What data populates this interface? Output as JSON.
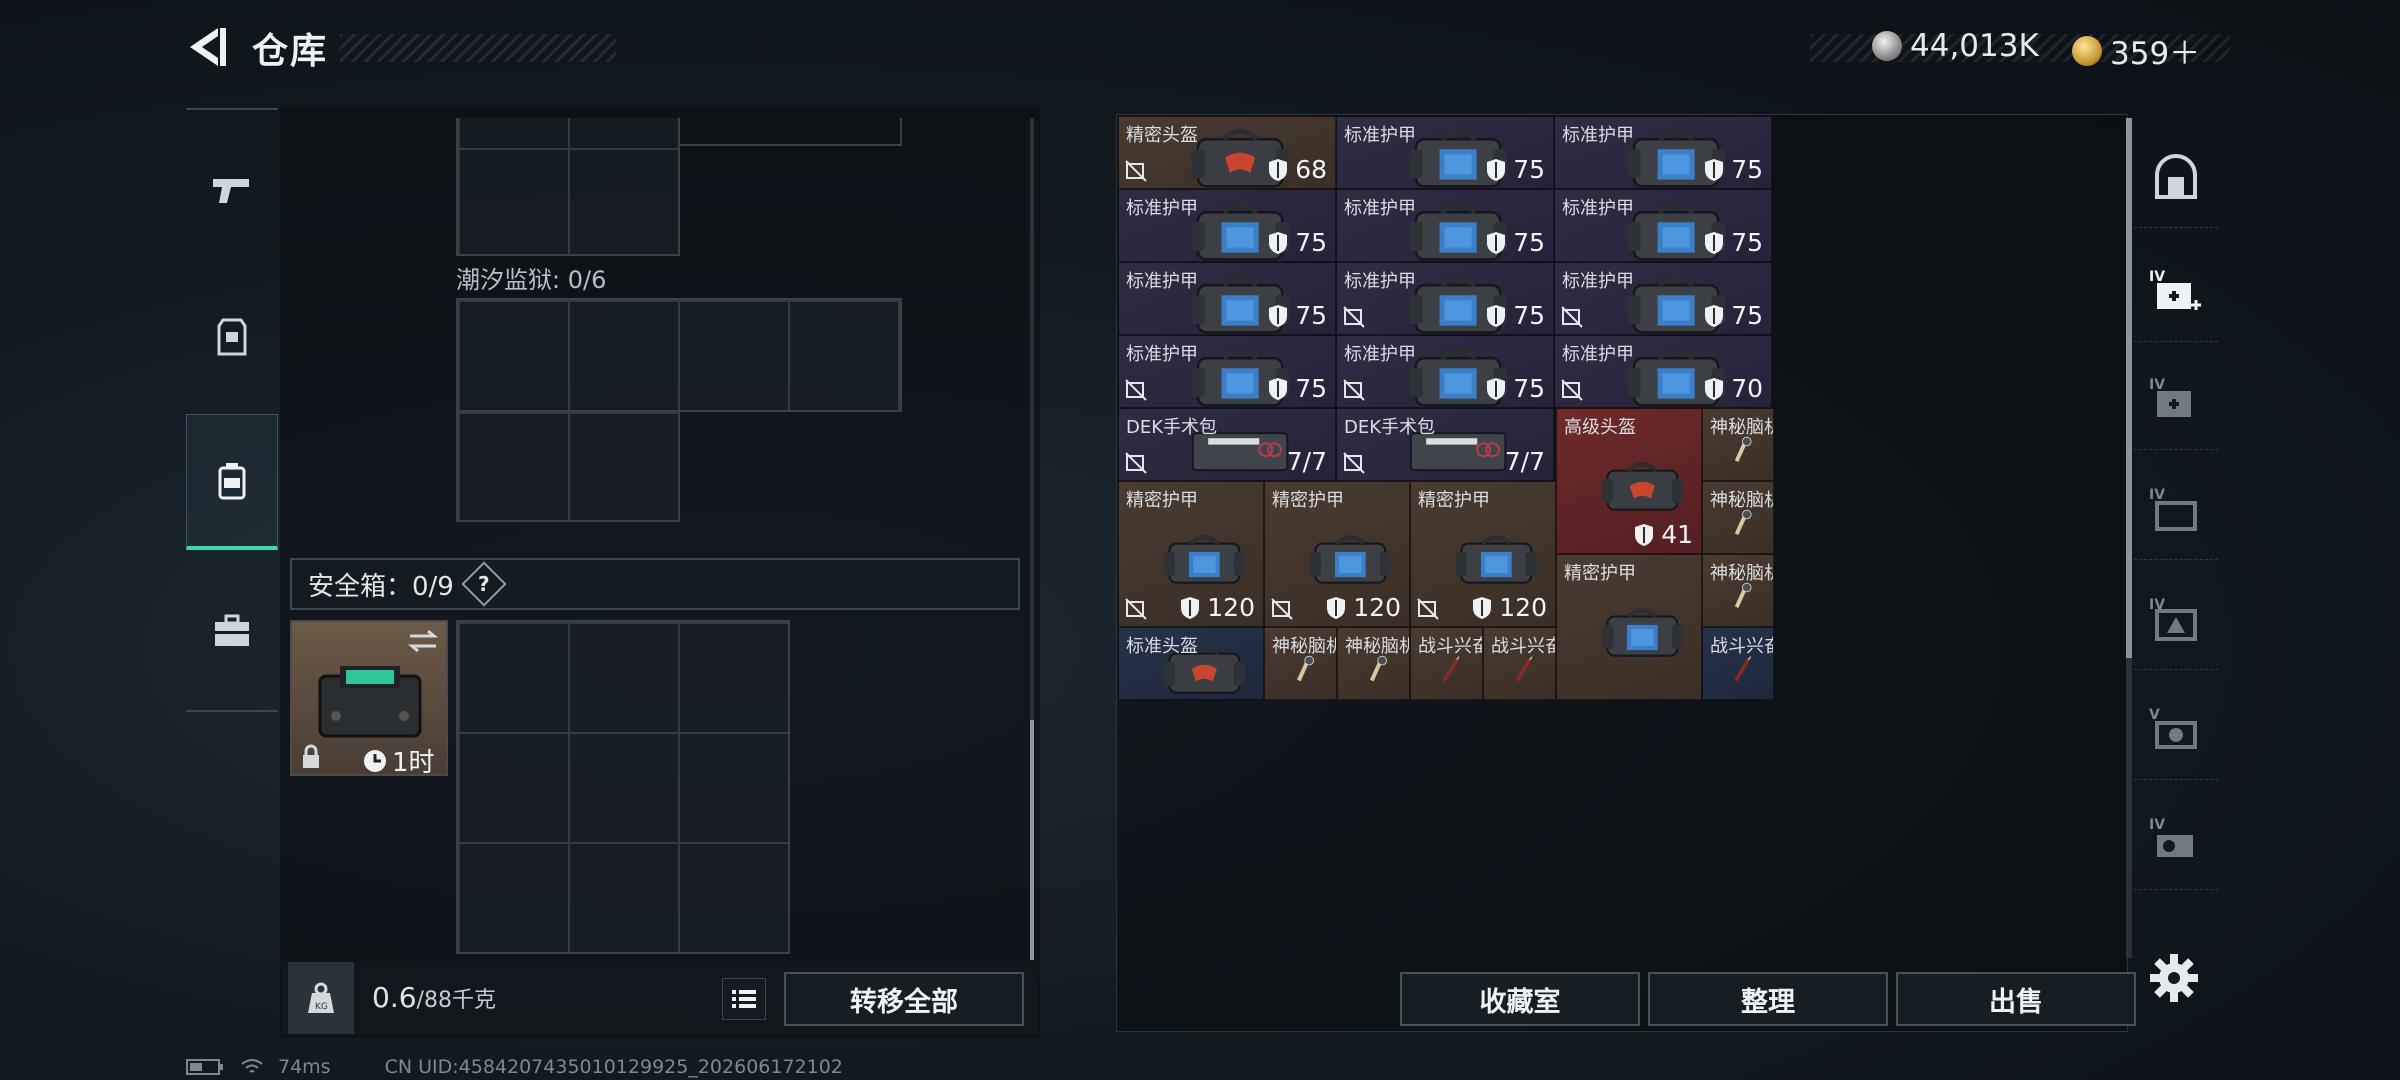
{
  "header": {
    "title": "仓库",
    "currency1": "44,013K",
    "currency2": "359＋"
  },
  "left_panel": {
    "prison_label": "潮汐监狱: 0/6",
    "safe_label": "安全箱：0/9",
    "safe_help": "?",
    "safe_timer": "1时",
    "weight_value": "0.6",
    "weight_capacity": "/88千克",
    "transfer_all": "转移全部"
  },
  "right_panel": {
    "buttons": [
      "收藏室",
      "整理",
      "出售"
    ],
    "items": [
      {
        "name": "精密头盔",
        "value": "68"
      },
      {
        "name": "标准护甲",
        "value": "75"
      },
      {
        "name": "标准护甲",
        "value": "75"
      },
      {
        "name": "标准护甲",
        "value": "75"
      },
      {
        "name": "标准护甲",
        "value": "75"
      },
      {
        "name": "标准护甲",
        "value": "75"
      },
      {
        "name": "标准护甲",
        "value": "75"
      },
      {
        "name": "标准护甲",
        "value": "75"
      },
      {
        "name": "标准护甲",
        "value": "75"
      },
      {
        "name": "标准护甲",
        "value": "75"
      },
      {
        "name": "标准护甲",
        "value": "75"
      },
      {
        "name": "标准护甲",
        "value": "70"
      },
      {
        "name": "DEK手术包",
        "value": "7/7"
      },
      {
        "name": "DEK手术包",
        "value": "7/7"
      },
      {
        "name": "高级头盔",
        "value": "41"
      },
      {
        "name": "神秘脑机...",
        "value": ""
      },
      {
        "name": "神秘脑机...",
        "value": ""
      },
      {
        "name": "精密护甲",
        "value": "120"
      },
      {
        "name": "精密护甲",
        "value": "120"
      },
      {
        "name": "精密护甲",
        "value": "120"
      },
      {
        "name": "精密护甲",
        "value": ""
      },
      {
        "name": "神秘脑机...",
        "value": ""
      },
      {
        "name": "标准头盔",
        "value": ""
      },
      {
        "name": "神秘脑机...",
        "value": ""
      },
      {
        "name": "神秘脑机...",
        "value": ""
      },
      {
        "name": "战斗兴奋剂",
        "value": ""
      },
      {
        "name": "战斗兴奋剂",
        "value": ""
      },
      {
        "name": "战斗兴奋剂",
        "value": ""
      }
    ]
  },
  "status": {
    "ping": "74ms",
    "uid": "CN UID:4584207435010129925_202606172102"
  },
  "colors": {
    "accent": "#3fd7a4",
    "rarity_brown": "#4a3b30",
    "rarity_purple": "#302c44",
    "rarity_blue": "#27324a",
    "rarity_red": "#6e2a2a"
  }
}
